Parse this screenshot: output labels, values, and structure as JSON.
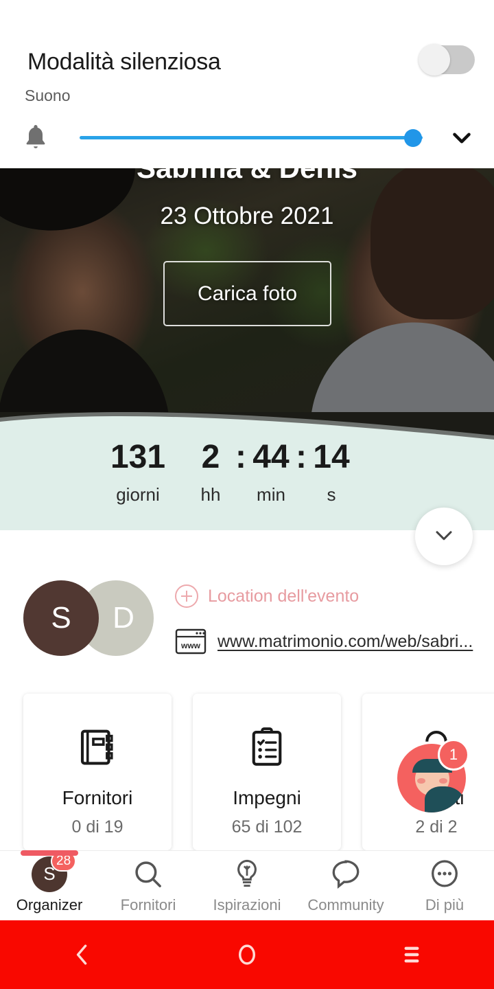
{
  "volume_panel": {
    "title": "Modalità silenziosa",
    "subtitle": "Suono",
    "toggle_state": "off",
    "slider_value": 100,
    "bell_icon": "bell-icon",
    "expand_icon": "chevron-down-icon",
    "track_color": "#29a3e8",
    "thumb_color": "#2196e8"
  },
  "hero": {
    "couple_names": "Sabrina & Denis",
    "date": "23 Ottobre 2021",
    "upload_button": "Carica foto"
  },
  "countdown": {
    "days": "131",
    "hours": "2",
    "minutes": "44",
    "seconds": "14",
    "colon": ":",
    "label_days": "giorni",
    "label_hours": "hh",
    "label_minutes": "min",
    "label_seconds": "s",
    "band_color": "#dfeee9",
    "expand_icon": "chevron-down-icon"
  },
  "couple": {
    "avatar_1": "S",
    "avatar_2": "D",
    "avatar_1_color": "#513832",
    "avatar_2_color": "#c9cabf",
    "location_label": "Location dell'evento",
    "location_color": "#e79ba0",
    "website_url": "www.matrimonio.com/web/sabri...",
    "website_icon": "www-browser-icon",
    "add_icon": "plus-circle-icon"
  },
  "cards": [
    {
      "title": "Fornitori",
      "sub": "0 di 19",
      "icon": "notebook-icon"
    },
    {
      "title": "Impegni",
      "sub": "65 di 102",
      "icon": "clipboard-checklist-icon"
    },
    {
      "title": "Invitati",
      "sub": "2 di 2",
      "icon": "guest-avatar-icon"
    }
  ],
  "guest_bubble": {
    "badge": "1",
    "color": "#f4615f"
  },
  "bottom_nav": {
    "active_index": 0,
    "indicator_color": "#ef5a63",
    "items": [
      {
        "label": "Organizer",
        "icon": "user-avatar-icon",
        "avatar_letter": "S",
        "badge": "28"
      },
      {
        "label": "Fornitori",
        "icon": "search-icon"
      },
      {
        "label": "Ispirazioni",
        "icon": "lightbulb-icon"
      },
      {
        "label": "Community",
        "icon": "chat-bubble-icon"
      },
      {
        "label": "Di più",
        "icon": "ellipsis-bubble-icon"
      }
    ]
  },
  "android_nav": {
    "background": "#f90800",
    "back_icon": "chevron-left-icon",
    "home_icon": "circle-icon",
    "recents_icon": "hamburger-icon"
  }
}
